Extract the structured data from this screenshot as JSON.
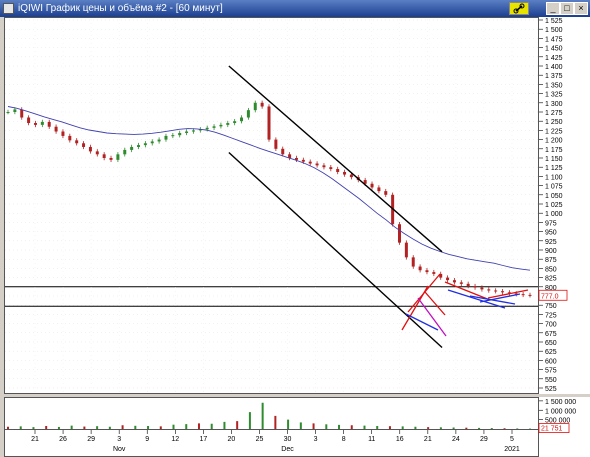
{
  "window": {
    "title": "iQIWI График цены и объёма #2 - [60 минут]",
    "buttons": {
      "minimize": "_",
      "maximize": "□",
      "close": "×"
    }
  },
  "colors": {
    "title_bg": "#1b3f8f",
    "candle_up": "#2e8b2e",
    "candle_down": "#b22222",
    "ma_line": "#4040b0",
    "trend_channel": "#000000",
    "red_markup": "#e01010",
    "blue_markup": "#2030e0",
    "magenta_markup": "#c010c0",
    "last_price_label": "#e01010"
  },
  "chart_data": {
    "type": "line",
    "price_axis": {
      "ticks": [
        "1 525",
        "1 500",
        "1 475",
        "1 450",
        "1 425",
        "1 400",
        "1 375",
        "1 350",
        "1 325",
        "1 300",
        "1 275",
        "1 250",
        "1 225",
        "1 200",
        "1 175",
        "1 150",
        "1 125",
        "1 100",
        "1 075",
        "1 050",
        "1 025",
        "1 000",
        "975",
        "950",
        "925",
        "900",
        "875",
        "850",
        "825",
        "800",
        "775",
        "750",
        "725",
        "700",
        "675",
        "650",
        "625",
        "600",
        "575",
        "550",
        "525"
      ],
      "ylim": [
        525,
        1525
      ]
    },
    "last_price_label": "777.0",
    "volume_axis": {
      "ticks": [
        "1 500 000",
        "1 000 000",
        "500 000"
      ],
      "last_volume_label": "21 751"
    },
    "x_ticks": [
      "21",
      "26",
      "29",
      "3",
      "9",
      "12",
      "17",
      "20",
      "25",
      "30",
      "3",
      "8",
      "11",
      "16",
      "21",
      "24",
      "29",
      "5"
    ],
    "x_month_labels": [
      {
        "label": "Nov",
        "at": "3"
      },
      {
        "label": "Dec",
        "at": "30"
      },
      {
        "label": "2021",
        "at": "5"
      }
    ],
    "price_series": [
      1275,
      1282,
      1260,
      1245,
      1240,
      1248,
      1235,
      1222,
      1210,
      1198,
      1190,
      1180,
      1168,
      1160,
      1150,
      1145,
      1160,
      1172,
      1180,
      1185,
      1190,
      1195,
      1200,
      1210,
      1212,
      1218,
      1222,
      1225,
      1228,
      1232,
      1236,
      1240,
      1245,
      1250,
      1260,
      1280,
      1300,
      1290,
      1200,
      1175,
      1160,
      1150,
      1145,
      1140,
      1135,
      1130,
      1125,
      1120,
      1112,
      1105,
      1098,
      1090,
      1080,
      1070,
      1060,
      1050,
      970,
      920,
      880,
      855,
      845,
      840,
      835,
      825,
      818,
      812,
      808,
      802,
      798,
      793,
      790,
      788,
      785,
      782,
      780,
      778,
      777
    ],
    "moving_average": [
      1290,
      1285,
      1278,
      1270,
      1262,
      1255,
      1248,
      1240,
      1232,
      1226,
      1222,
      1218,
      1216,
      1215,
      1214,
      1215,
      1217,
      1220,
      1224,
      1228,
      1230,
      1229,
      1226,
      1220,
      1212,
      1203,
      1194,
      1185,
      1176,
      1168,
      1160,
      1152,
      1144,
      1135,
      1124,
      1110,
      1094,
      1076,
      1058,
      1040,
      1020,
      1000,
      982,
      962,
      945,
      930,
      916,
      905,
      896,
      888,
      882,
      876,
      872,
      868,
      864,
      858,
      852,
      848,
      845
    ],
    "volume_series": [
      120000,
      140000,
      100000,
      160000,
      110000,
      180000,
      130000,
      150000,
      120000,
      200000,
      170000,
      160000,
      140000,
      230000,
      260000,
      300000,
      280000,
      380000,
      420000,
      900000,
      1400000,
      700000,
      500000,
      350000,
      300000,
      250000,
      220000,
      200000,
      180000,
      160000,
      150000,
      140000,
      120000,
      100000,
      90000,
      80000,
      70000,
      60000,
      50000,
      40000,
      30000,
      21751
    ],
    "horizontal_levels": [
      800,
      747
    ],
    "trend_channel": {
      "upper": [
        [
          1400,
          0.42
        ],
        [
          895,
          0.82
        ]
      ],
      "lower": [
        [
          1165,
          0.42
        ],
        [
          635,
          0.82
        ]
      ]
    }
  }
}
